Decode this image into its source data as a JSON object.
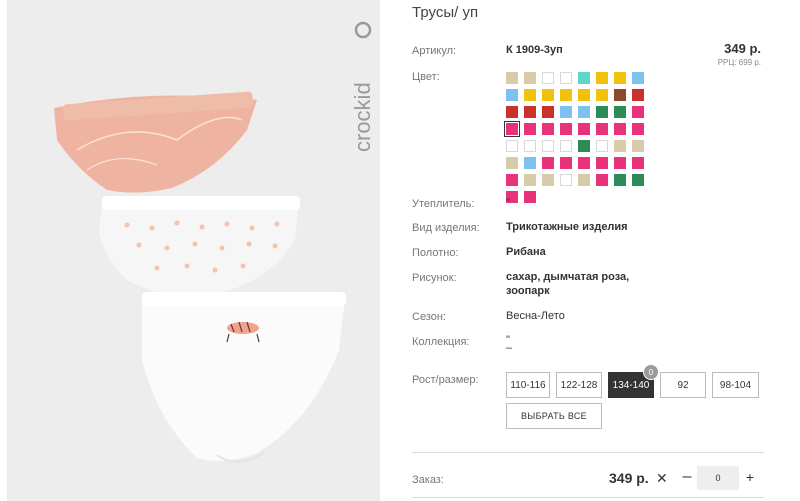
{
  "product": {
    "title": "Трусы/ уп",
    "brand": "crockid"
  },
  "details": {
    "article_label": "Артикул:",
    "article_value": "К 1909-3уп",
    "price": "349 р.",
    "rrp": "РРЦ: 699 р.",
    "color_label": "Цвет:",
    "insulation_label": "Утеплитель:",
    "insulation_value": "\"",
    "type_label": "Вид изделия:",
    "type_value": "Трикотажные изделия",
    "fabric_label": "Полотно:",
    "fabric_value": "Рибана",
    "pattern_label": "Рисунок:",
    "pattern_value_1": "сахар, дымчатая роза,",
    "pattern_value_2": "зоопарк",
    "season_label": "Сезон:",
    "season_value": "Весна-Лето",
    "collection_label": "Коллекция:",
    "collection_value_1": "\"",
    "collection_value_2": "–",
    "size_label": "Рост/размер:"
  },
  "colors": {
    "selected_index": 24,
    "swatches": [
      "#d8cbaa",
      "#d8cbaa",
      "#ffffff",
      "#ffffff",
      "#5dd6c7",
      "#f0c20d",
      "#f0c20d",
      "#7cc1f0",
      "#7cc1f0",
      "#f0c20d",
      "#f0c20d",
      "#f0c20d",
      "#f0c20d",
      "#f0c20d",
      "#8b4a2b",
      "#c9322c",
      "#c9322c",
      "#c9322c",
      "#c9322c",
      "#7cc1f0",
      "#7cc1f0",
      "#2e8b57",
      "#2e8b57",
      "#e8337a",
      "#e8337a",
      "#e8337a",
      "#e8337a",
      "#e8337a",
      "#e8337a",
      "#e8337a",
      "#e8337a",
      "#e8337a",
      "#ffffff",
      "#ffffff",
      "#ffffff",
      "#ffffff",
      "#2e8b57",
      "#ffffff",
      "#d8cbaa",
      "#d8cbaa",
      "#d8cbaa",
      "#7cc1f0",
      "#e8337a",
      "#e8337a",
      "#e8337a",
      "#e8337a",
      "#e8337a",
      "#e8337a",
      "#e8337a",
      "#d8cbaa",
      "#d8cbaa",
      "#ffffff",
      "#d8cbaa",
      "#e8337a",
      "#2e8b57",
      "#2e8b57",
      "#e8337a",
      "#e8337a"
    ]
  },
  "sizes": [
    {
      "label": "110-116",
      "active": false
    },
    {
      "label": "122-128",
      "active": false
    },
    {
      "label": "134-140",
      "active": true,
      "badge": "0"
    },
    {
      "label": "92",
      "active": false
    },
    {
      "label": "98-104",
      "active": false
    }
  ],
  "select_all_label": "ВЫБРАТЬ ВСЕ",
  "order": {
    "label": "Заказ:",
    "price": "349 р.",
    "remove_symbol": "✕",
    "minus": "–",
    "qty": "0",
    "plus": "+"
  }
}
